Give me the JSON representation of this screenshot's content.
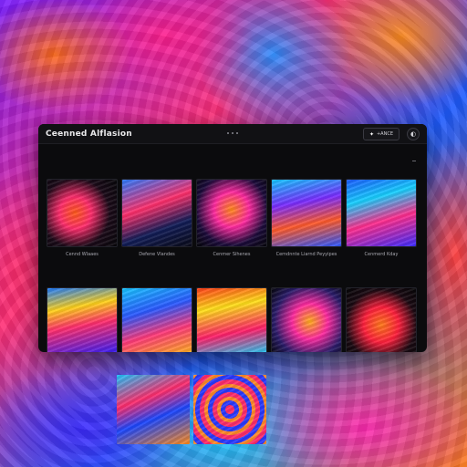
{
  "window": {
    "title": "Ceenned Alflasion",
    "action_button_label": "+ANCE",
    "action_icon": "sparkle-icon",
    "round_button_icon": "moon-icon"
  },
  "gallery": {
    "row1": [
      {
        "caption": "Cennd Wlaaes",
        "style": "t1"
      },
      {
        "caption": "Defene Vlandes",
        "style": "t2"
      },
      {
        "caption": "Cenmer Sihenes",
        "style": "t3"
      },
      {
        "caption": "Cemdnnte Liarnd Peyyipes",
        "style": "t4"
      },
      {
        "caption": "Cenmerd Kday",
        "style": "t5"
      }
    ],
    "row2": [
      {
        "style": "t6"
      },
      {
        "style": "t7"
      },
      {
        "style": "t8"
      },
      {
        "style": "t9"
      },
      {
        "style": "t10"
      }
    ]
  },
  "floating_thumbs": [
    {
      "style": "f1"
    },
    {
      "style": "f2"
    }
  ]
}
